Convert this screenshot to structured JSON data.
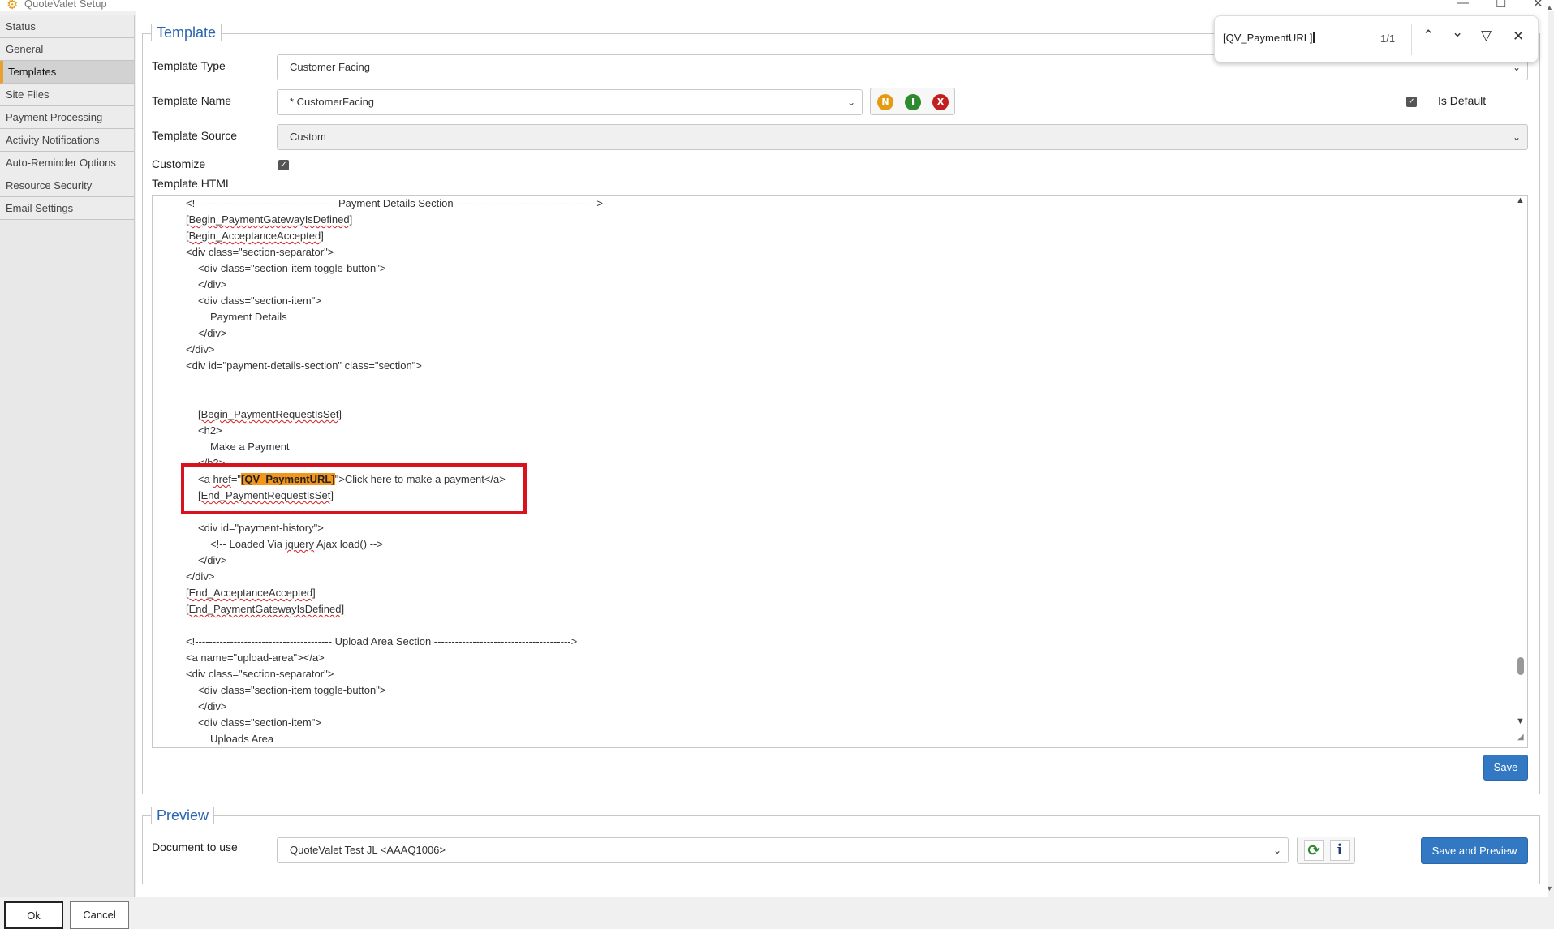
{
  "titlebar": {
    "title": "QuoteValet Setup",
    "minimize": "—",
    "maximize": "☐",
    "close": "✕"
  },
  "sidebar": {
    "items": [
      {
        "label": "Status"
      },
      {
        "label": "General"
      },
      {
        "label": "Templates",
        "active": true
      },
      {
        "label": "Site Files"
      },
      {
        "label": "Payment Processing"
      },
      {
        "label": "Activity Notifications"
      },
      {
        "label": "Auto-Reminder Options"
      },
      {
        "label": "Resource Security"
      },
      {
        "label": "Email Settings"
      }
    ]
  },
  "template": {
    "legend": "Template",
    "type_label": "Template Type",
    "type_value": "Customer Facing",
    "name_label": "Template Name",
    "name_value": "* CustomerFacing",
    "source_label": "Template Source",
    "source_value": "Custom",
    "customize_label": "Customize",
    "html_label": "Template HTML",
    "is_default_label": "Is Default",
    "save_label": "Save",
    "buttons": {
      "new": "N",
      "info": "I",
      "delete": "X"
    }
  },
  "code": {
    "l1": "<!---------------------------------------- Payment Details Section ---------------------------------------->",
    "l2": "[Begin_PaymentGatewayIsDefined]",
    "l3": "[Begin_AcceptanceAccepted]",
    "l4": "<div class=\"section-separator\">",
    "l5": "<div class=\"section-item toggle-button\">",
    "l6": "</div>",
    "l7": "<div class=\"section-item\">",
    "l8": "Payment Details",
    "l9": "</div>",
    "l10": "</div>",
    "l11": "<div id=\"payment-details-section\" class=\"section\">",
    "l12": "[Begin_PaymentRequestIsSet]",
    "l13": "<h2>",
    "l14": "Make a Payment",
    "l15": "</h2>",
    "l16_pre": "<a ",
    "l16_href": "href",
    "l16_eq": "=\"",
    "l16_hl": "[QV_PaymentURL]",
    "l16_post": "\">Click here to make a payment</a>",
    "l17": "[End_PaymentRequestIsSet]",
    "l18": "<div id=\"payment-history\">",
    "l19_pre": "<!-- Loaded Via ",
    "l19_sq": "jquery",
    "l19_post": " Ajax load() -->",
    "l20": "</div>",
    "l21": "</div>",
    "l22": "[End_AcceptanceAccepted]",
    "l23": "[End_PaymentGatewayIsDefined]",
    "l24": "<!--------------------------------------- Upload Area Section --------------------------------------->",
    "l25": "<a name=\"upload-area\"></a>",
    "l26": "<div class=\"section-separator\">",
    "l27": "<div class=\"section-item toggle-button\">",
    "l28": "</div>",
    "l29": "<div class=\"section-item\">",
    "l30": "Uploads Area"
  },
  "preview": {
    "legend": "Preview",
    "doc_label": "Document to use",
    "doc_value": "QuoteValet Test JL <AAAQ1006>",
    "save_preview_label": "Save and Preview",
    "info_glyph": "i",
    "refresh_glyph": "⟳"
  },
  "findbar": {
    "query": "[QV_PaymentURL]",
    "count": "1/1"
  },
  "footer": {
    "ok_label": "Ok",
    "cancel_label": "Cancel"
  }
}
